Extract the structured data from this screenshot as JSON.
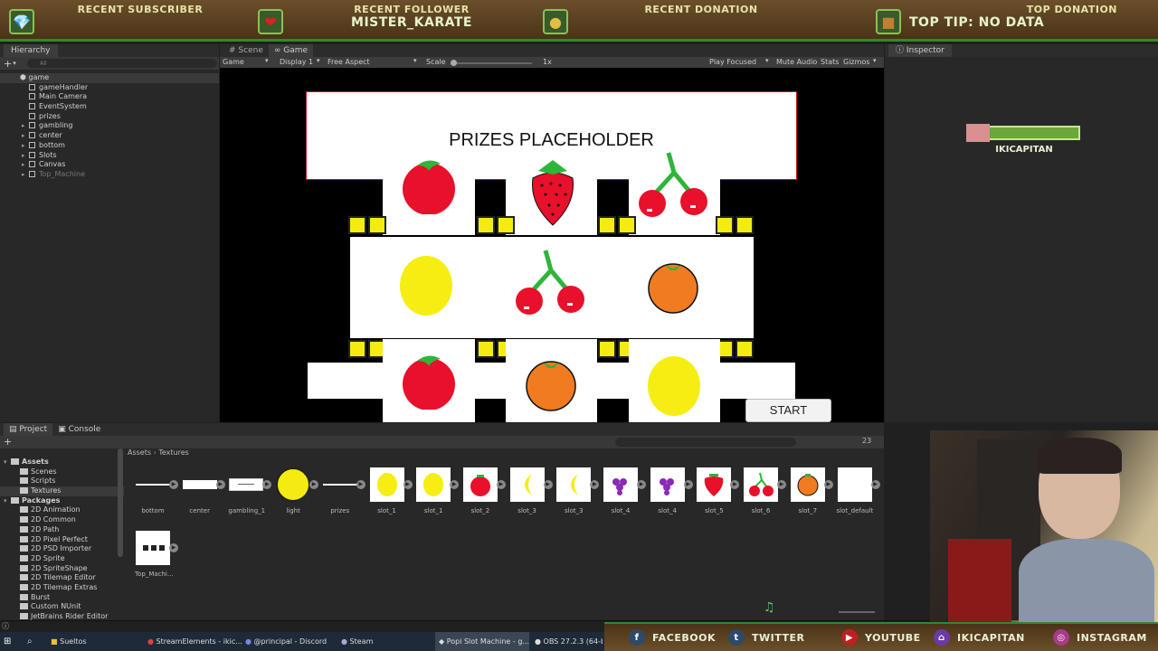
{
  "banner": {
    "sections": [
      {
        "heading": "RECENT SUBSCRIBER",
        "value": "",
        "icon": "gem-icon"
      },
      {
        "heading": "RECENT FOLLOWER",
        "value": "MISTER_KARATE",
        "icon": "heart-icon"
      },
      {
        "heading": "RECENT DONATION",
        "value": "",
        "icon": "coin-icon"
      },
      {
        "heading": "TOP DONATION",
        "value": "TOP TIP: NO DATA",
        "icon": "chest-icon"
      }
    ]
  },
  "hierarchy": {
    "tab": "Hierarchy",
    "search_placeholder": "All",
    "root": "game",
    "items": [
      "gameHandler",
      "Main Camera",
      "EventSystem",
      "prizes",
      "gambling",
      "center",
      "bottom",
      "Slots",
      "Canvas",
      "Top_Machine"
    ]
  },
  "game_view": {
    "tabs": [
      "Scene",
      "Game"
    ],
    "toolbar": {
      "mode": "Game",
      "display": "Display 1",
      "aspect": "Free Aspect",
      "scale_label": "Scale",
      "scale_value": "1x",
      "play_focused": "Play Focused",
      "mute_audio": "Mute Audio",
      "stats": "Stats",
      "gizmos": "Gizmos"
    },
    "prizes_text": "PRIZES PLACEHOLDER",
    "start_button": "START",
    "reels": {
      "top": [
        "tomato",
        "strawberry",
        "cherry"
      ],
      "middle": [
        "lemon",
        "cherry",
        "orange"
      ],
      "bottom": [
        "tomato",
        "orange",
        "lemon"
      ]
    }
  },
  "inspector": {
    "tab": "Inspector",
    "overlay_name": "IKICAPITAN"
  },
  "project": {
    "tabs": [
      "Project",
      "Console"
    ],
    "breadcrumb": [
      "Assets",
      "Textures"
    ],
    "count": "23",
    "tree": [
      {
        "label": "Assets",
        "level": 0,
        "bold": true
      },
      {
        "label": "Scenes",
        "level": 1
      },
      {
        "label": "Scripts",
        "level": 1
      },
      {
        "label": "Textures",
        "level": 1,
        "selected": true
      },
      {
        "label": "Packages",
        "level": 0,
        "bold": true
      },
      {
        "label": "2D Animation",
        "level": 1
      },
      {
        "label": "2D Common",
        "level": 1
      },
      {
        "label": "2D Path",
        "level": 1
      },
      {
        "label": "2D Pixel Perfect",
        "level": 1
      },
      {
        "label": "2D PSD Importer",
        "level": 1
      },
      {
        "label": "2D Sprite",
        "level": 1
      },
      {
        "label": "2D SpriteShape",
        "level": 1
      },
      {
        "label": "2D Tilemap Editor",
        "level": 1
      },
      {
        "label": "2D Tilemap Extras",
        "level": 1
      },
      {
        "label": "Burst",
        "level": 1
      },
      {
        "label": "Custom NUnit",
        "level": 1
      },
      {
        "label": "JetBrains Rider Editor",
        "level": 1
      }
    ],
    "assets": [
      {
        "label": "bottom",
        "thumb": "line"
      },
      {
        "label": "center",
        "thumb": "bar"
      },
      {
        "label": "gambling_1",
        "thumb": "box"
      },
      {
        "label": "light",
        "thumb": "light"
      },
      {
        "label": "prizes",
        "thumb": "line"
      },
      {
        "label": "slot_1",
        "thumb": "lemon"
      },
      {
        "label": "slot_1",
        "thumb": "lemon"
      },
      {
        "label": "slot_2",
        "thumb": "tomato"
      },
      {
        "label": "slot_3",
        "thumb": "banana"
      },
      {
        "label": "slot_3",
        "thumb": "banana"
      },
      {
        "label": "slot_4",
        "thumb": "grape"
      },
      {
        "label": "slot_4",
        "thumb": "grape"
      },
      {
        "label": "slot_5",
        "thumb": "strawberry"
      },
      {
        "label": "slot_6",
        "thumb": "cherry"
      },
      {
        "label": "slot_7",
        "thumb": "orange"
      },
      {
        "label": "slot_default",
        "thumb": "blank"
      },
      {
        "label": "Top_Machi...",
        "thumb": "dots"
      }
    ]
  },
  "taskbar": {
    "items": [
      "Sueltos",
      "StreamElements - ikic...",
      "@principal - Discord",
      "Steam",
      "Popi Slot Machine - g...",
      "OBS 27.2.3 (64-b"
    ]
  },
  "socials": [
    {
      "label": "FACEBOOK",
      "icon": "facebook-icon"
    },
    {
      "label": "TWITTER",
      "icon": "twitter-icon"
    },
    {
      "label": "YOUTUBE",
      "icon": "youtube-icon"
    },
    {
      "label": "IKICAPITAN",
      "icon": "twitch-icon"
    },
    {
      "label": "INSTAGRAM",
      "icon": "instagram-icon"
    }
  ],
  "colors": {
    "accent_green": "#2e8a2a",
    "editor_bg": "#202020",
    "light_yellow": "#f4ec10"
  }
}
